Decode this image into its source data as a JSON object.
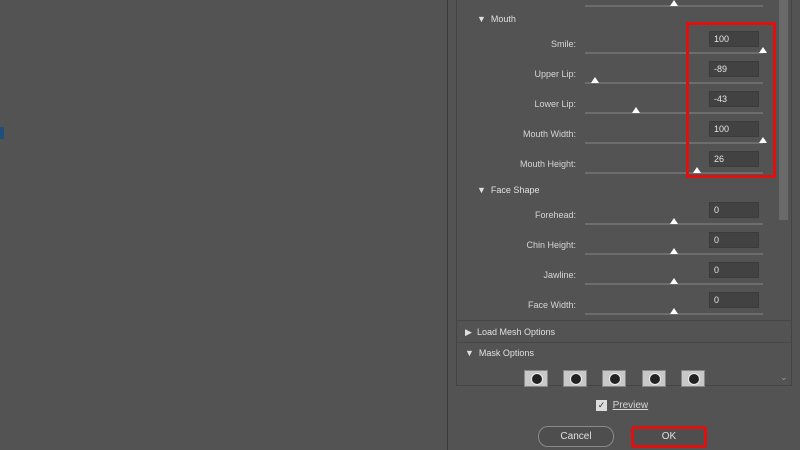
{
  "sections": {
    "mouth": "Mouth",
    "face_shape": "Face Shape",
    "load_mesh": "Load Mesh Options",
    "mask_options": "Mask Options"
  },
  "mouth": [
    {
      "label": "Smile:",
      "value": "100"
    },
    {
      "label": "Upper Lip:",
      "value": "-89"
    },
    {
      "label": "Lower Lip:",
      "value": "-43"
    },
    {
      "label": "Mouth Width:",
      "value": "100"
    },
    {
      "label": "Mouth Height:",
      "value": "26"
    }
  ],
  "face_shape": [
    {
      "label": "Forehead:",
      "value": "0"
    },
    {
      "label": "Chin Height:",
      "value": "0"
    },
    {
      "label": "Jawline:",
      "value": "0"
    },
    {
      "label": "Face Width:",
      "value": "0"
    }
  ],
  "preview": {
    "label": "Preview",
    "checked": true
  },
  "buttons": {
    "cancel": "Cancel",
    "ok": "OK"
  },
  "highlight_color": "#e01010"
}
